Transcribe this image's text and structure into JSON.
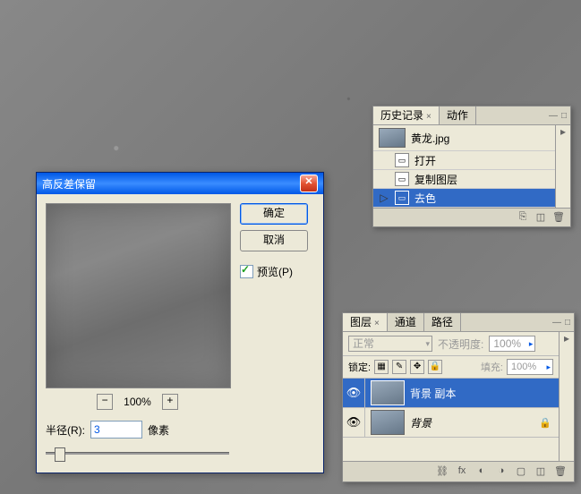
{
  "dialog": {
    "title": "高反差保留",
    "ok": "确定",
    "cancel": "取消",
    "preview_label": "预览(P)",
    "zoom": "100%",
    "radius_label": "半径(R):",
    "radius_value": "3",
    "radius_unit": "像素"
  },
  "history": {
    "tab_history": "历史记录",
    "tab_actions": "动作",
    "snapshot": "黄龙.jpg",
    "items": [
      "打开",
      "复制图层",
      "去色"
    ]
  },
  "layers": {
    "tab_layers": "图层",
    "tab_channels": "通道",
    "tab_paths": "路径",
    "blend_mode": "正常",
    "opacity_label": "不透明度:",
    "opacity_value": "100%",
    "lock_label": "锁定:",
    "fill_label": "填充:",
    "fill_value": "100%",
    "items": [
      {
        "name": "背景 副本",
        "locked": false
      },
      {
        "name": "背景",
        "locked": true
      }
    ]
  }
}
